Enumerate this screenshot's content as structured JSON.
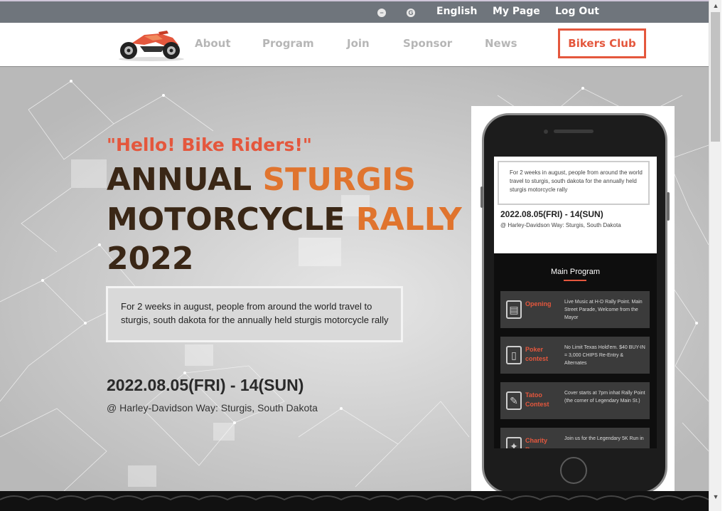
{
  "topbar": {
    "language": "English",
    "my_page": "My Page",
    "logout": "Log Out",
    "icons": [
      "minus-circle-icon",
      "google-icon"
    ]
  },
  "nav": {
    "items": [
      "About",
      "Program",
      "Join",
      "Sponsor",
      "News"
    ],
    "bikers_club": "Bikers Club"
  },
  "hero": {
    "greeting": "\"Hello! Bike Riders!\"",
    "title": {
      "line1_dark": "ANNUAL ",
      "line1_orange": "STURGIS",
      "line2_dark": "MOTORCYCLE ",
      "line2_orange": "RALLY",
      "line3": "2022"
    },
    "description": "For 2 weeks in august, people from around the world travel to sturgis, south dakota for the annually held sturgis motorcycle rally",
    "date": "2022.08.05(FRI) - 14(SUN)",
    "location": "@ Harley-Davidson Way: Sturgis, South Dakota"
  },
  "phone": {
    "description": "For 2 weeks in august, people from around the world travel to sturgis, south dakota for the annually held sturgis motorcycle rally",
    "date": "2022.08.05(FRI) - 14(SUN)",
    "location": "@ Harley-Davidson Way: Sturgis, South Dakota",
    "main_program": "Main Program",
    "programs": [
      {
        "label": "Opening",
        "text": "Live Music at H-D Rally Point. Main Street Parade, Welcome from the Mayor",
        "icon": "podium-icon"
      },
      {
        "label": "Poker contest",
        "text": "No Limit Texas Hold'em. $40 BUY-IN = 3,000 CHIPS Re-Entry & Alternates",
        "icon": "cards-icon"
      },
      {
        "label": "Tatoo Contest",
        "text": "Cover starts at 7pm inhat Rally Point (the corner of Legendary Main St.)",
        "icon": "tattoo-icon"
      },
      {
        "label": "Charity Run",
        "text": "Join us for the Legendary 5K Run in",
        "icon": "runner-icon"
      }
    ]
  },
  "colors": {
    "accent": "#e4573d",
    "title_dark": "#3a2716",
    "title_orange": "#e0742e",
    "topbar": "#6f757c"
  }
}
